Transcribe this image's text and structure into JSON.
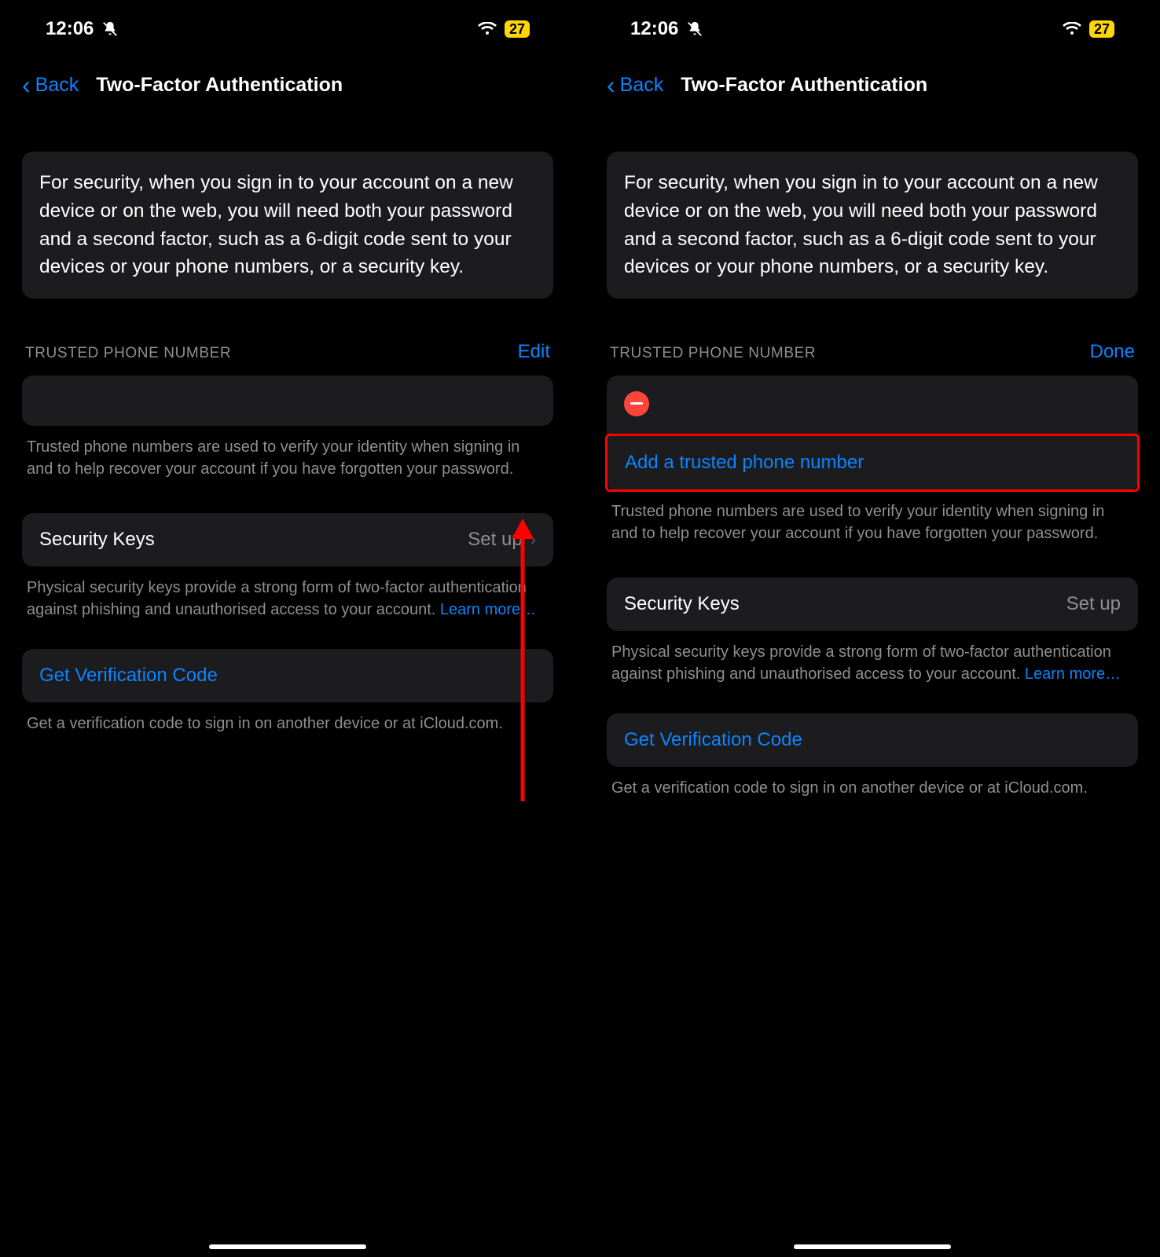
{
  "status": {
    "time": "12:06",
    "battery": "27"
  },
  "nav": {
    "back": "Back",
    "title": "Two-Factor Authentication"
  },
  "intro": "For security, when you sign in to your account on a new device or on the web, you will need both your password and a second factor, such as a 6-digit code sent to your devices or your phone numbers, or a security key.",
  "trusted": {
    "header": "TRUSTED PHONE NUMBER",
    "edit": "Edit",
    "done": "Done",
    "add": "Add a trusted phone number",
    "footer": "Trusted phone numbers are used to verify your identity when signing in and to help recover your account if you have forgotten your password."
  },
  "securityKeys": {
    "title": "Security Keys",
    "value": "Set up",
    "footer_prefix": "Physical security keys provide a strong form of two-factor authentication against phishing and unauthorised access to your account. ",
    "learn_more": "Learn more…"
  },
  "verification": {
    "action": "Get Verification Code",
    "footer": "Get a verification code to sign in on another device or at iCloud.com."
  }
}
